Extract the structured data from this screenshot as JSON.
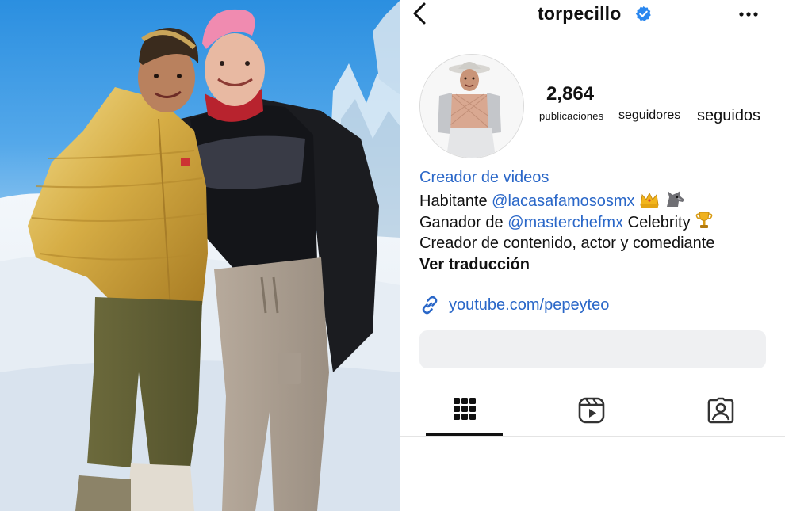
{
  "profile": {
    "username": "torpecillo",
    "stats": {
      "posts_count": "2,864",
      "posts_label": "publicaciones",
      "followers_label": "seguidores",
      "following_label": "seguidos"
    },
    "bio": {
      "category": "Creador de videos",
      "line1_prefix": "Habitante ",
      "line1_mention": "@lacasafamososmx",
      "line2_prefix": "Ganador de ",
      "line2_mention": "@masterchefmx",
      "line2_suffix": " Celebrity",
      "line3": "Creador de contenido, actor y comediante",
      "translate": "Ver traducción"
    },
    "link": {
      "url": "youtube.com/pepeyteo",
      "icon": "chain-link-icon"
    },
    "tabs": [
      {
        "name": "posts-grid",
        "icon": "grid-icon",
        "active": true
      },
      {
        "name": "reels",
        "icon": "reels-icon",
        "active": false
      },
      {
        "name": "tagged",
        "icon": "tagged-user-icon",
        "active": false
      }
    ]
  },
  "icons": {
    "back": "chevron-left-icon",
    "verified": "verified-badge-icon",
    "more": "more-dots-icon"
  },
  "colors": {
    "link_blue": "#2a67c8",
    "verified_blue": "#2a87ef",
    "highlight_bg": "#eff0f2",
    "jacket_gold": "#d9b44a"
  }
}
